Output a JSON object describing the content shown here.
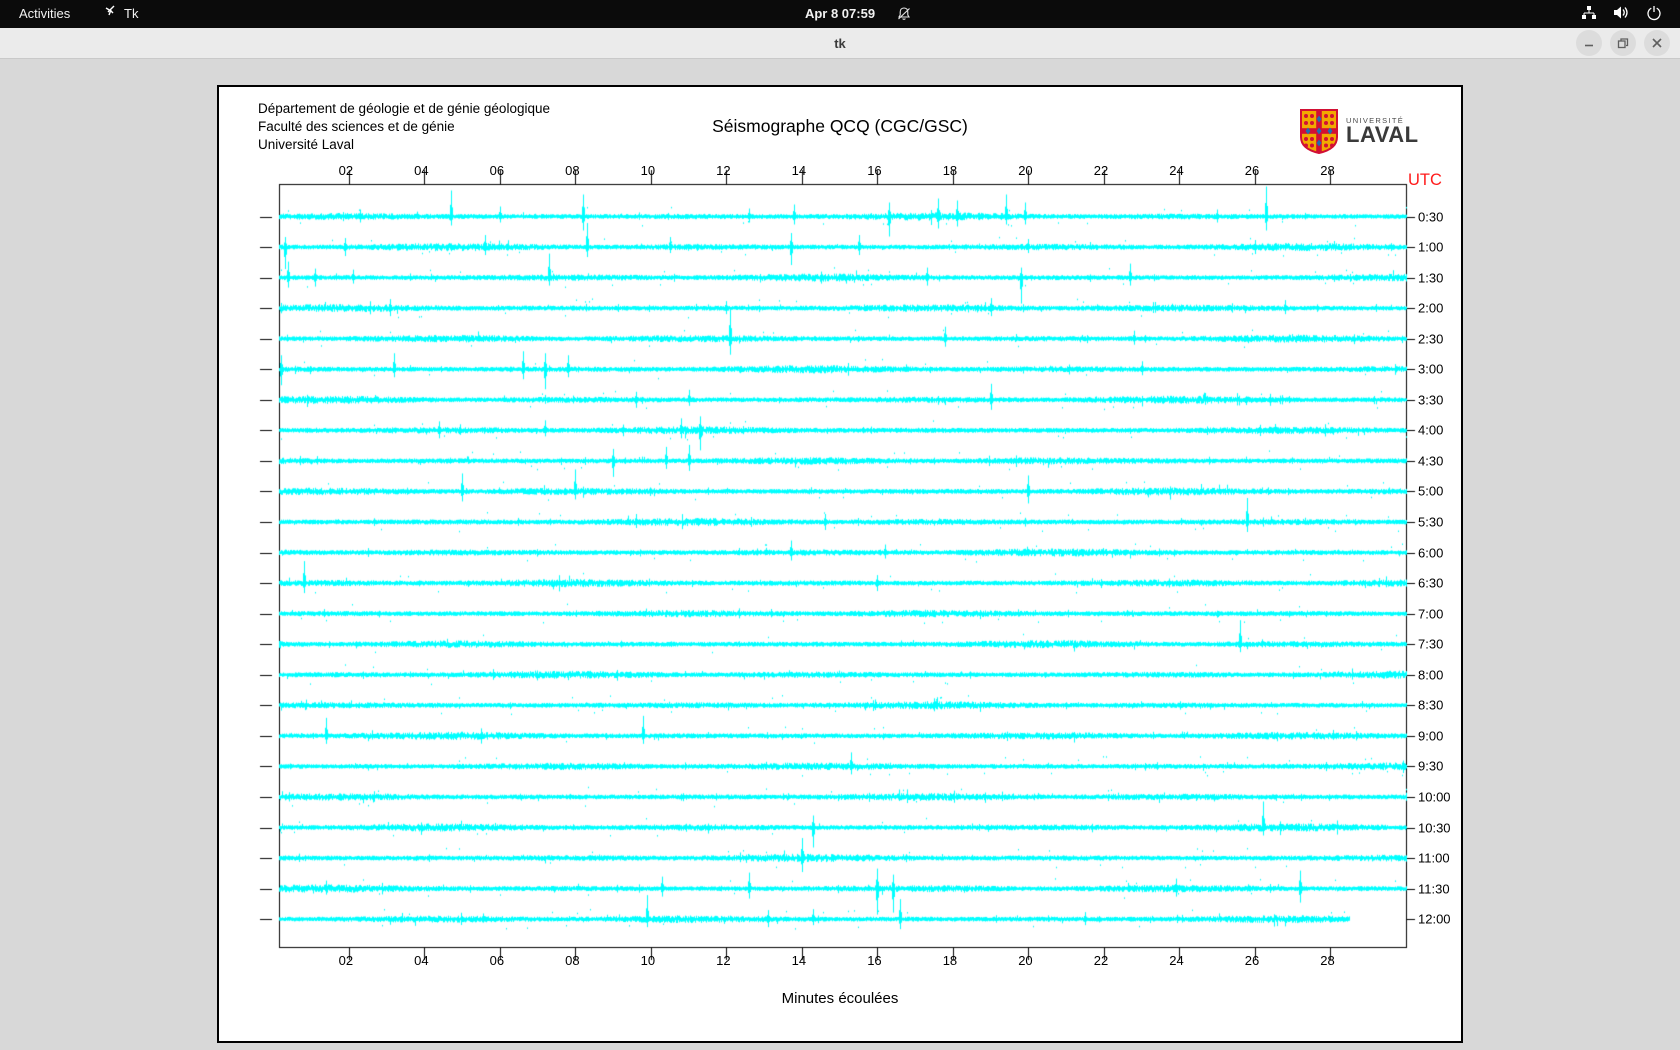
{
  "topbar": {
    "activities": "Activities",
    "app_name": "Tk",
    "clock": "Apr 8 07:59"
  },
  "window": {
    "title": "tk"
  },
  "header": {
    "line1": "Département de géologie et de génie géologique",
    "line2": "Faculté des sciences et de génie",
    "line3": "Université Laval"
  },
  "logo": {
    "small": "UNIVERSITÉ",
    "large": "LAVAL"
  },
  "chart_data": {
    "type": "line",
    "title": "Séismographe QCQ (CGC/GSC)",
    "xlabel": "Minutes écoulées",
    "ylabel": "UTC",
    "xlim": [
      0.15,
      30
    ],
    "x_ticks": [
      "02",
      "04",
      "06",
      "08",
      "10",
      "12",
      "14",
      "16",
      "18",
      "20",
      "22",
      "24",
      "26",
      "28"
    ],
    "x_tick_minutes": [
      2,
      4,
      6,
      8,
      10,
      12,
      14,
      16,
      18,
      20,
      22,
      24,
      26,
      28
    ],
    "trace_color": "#00ffff",
    "axis_color": "#000000",
    "utc_color": "#ff1a1a",
    "noise_seed": 1337,
    "noise_base_amp": 2.4,
    "rows": [
      {
        "label": "0:30",
        "end_minute": 30,
        "spikes": [
          [
            2.3,
            7,
            6
          ],
          [
            4.7,
            26,
            9
          ],
          [
            6.0,
            10,
            6
          ],
          [
            8.2,
            22,
            14
          ],
          [
            12.6,
            8,
            6
          ],
          [
            13.8,
            12,
            8
          ],
          [
            16.3,
            14,
            20
          ],
          [
            17.6,
            18,
            12
          ],
          [
            18.1,
            16,
            10
          ],
          [
            19.4,
            22,
            8
          ],
          [
            19.9,
            14,
            8
          ],
          [
            25.0,
            7,
            6
          ],
          [
            26.3,
            30,
            14
          ]
        ]
      },
      {
        "label": "1:00",
        "end_minute": 30,
        "spikes": [
          [
            0.3,
            10,
            22
          ],
          [
            1.9,
            9,
            9
          ],
          [
            5.6,
            12,
            8
          ],
          [
            8.3,
            24,
            10
          ],
          [
            10.5,
            10,
            6
          ],
          [
            13.7,
            14,
            18
          ],
          [
            15.5,
            12,
            8
          ],
          [
            20.0,
            8,
            6
          ],
          [
            26.0,
            7,
            7
          ]
        ]
      },
      {
        "label": "1:30",
        "end_minute": 30,
        "spikes": [
          [
            0.4,
            16,
            10
          ],
          [
            1.1,
            9,
            9
          ],
          [
            2.1,
            8,
            6
          ],
          [
            7.3,
            24,
            8
          ],
          [
            14.5,
            6,
            6
          ],
          [
            17.3,
            10,
            8
          ],
          [
            19.8,
            10,
            26
          ],
          [
            22.7,
            14,
            8
          ]
        ]
      },
      {
        "label": "2:00",
        "end_minute": 30,
        "spikes": [
          [
            3.1,
            9,
            8
          ],
          [
            12.0,
            7,
            6
          ],
          [
            19.0,
            10,
            8
          ],
          [
            26.8,
            8,
            6
          ]
        ]
      },
      {
        "label": "2:30",
        "end_minute": 30,
        "spikes": [
          [
            12.1,
            30,
            16
          ],
          [
            17.8,
            12,
            8
          ],
          [
            22.8,
            8,
            6
          ]
        ]
      },
      {
        "label": "3:00",
        "end_minute": 30,
        "spikes": [
          [
            0.2,
            14,
            16
          ],
          [
            3.2,
            16,
            8
          ],
          [
            6.6,
            18,
            10
          ],
          [
            7.2,
            16,
            20
          ],
          [
            7.8,
            14,
            8
          ],
          [
            23.0,
            8,
            6
          ]
        ]
      },
      {
        "label": "3:30",
        "end_minute": 30,
        "spikes": [
          [
            9.6,
            8,
            8
          ],
          [
            11.0,
            10,
            6
          ],
          [
            19.0,
            16,
            10
          ],
          [
            26.4,
            6,
            6
          ]
        ]
      },
      {
        "label": "4:00",
        "end_minute": 30,
        "spikes": [
          [
            4.4,
            9,
            8
          ],
          [
            7.2,
            10,
            6
          ],
          [
            10.8,
            12,
            8
          ],
          [
            11.3,
            14,
            20
          ]
        ]
      },
      {
        "label": "4:30",
        "end_minute": 30,
        "spikes": [
          [
            9.0,
            12,
            16
          ],
          [
            10.4,
            14,
            8
          ],
          [
            11.0,
            16,
            10
          ]
        ]
      },
      {
        "label": "5:00",
        "end_minute": 30,
        "spikes": [
          [
            5.0,
            18,
            10
          ],
          [
            8.0,
            22,
            8
          ],
          [
            20.0,
            16,
            12
          ]
        ]
      },
      {
        "label": "5:30",
        "end_minute": 30,
        "spikes": [
          [
            9.6,
            8,
            6
          ],
          [
            14.6,
            8,
            8
          ],
          [
            25.8,
            24,
            10
          ]
        ]
      },
      {
        "label": "6:00",
        "end_minute": 30,
        "spikes": [
          [
            13.7,
            12,
            8
          ],
          [
            16.2,
            8,
            6
          ]
        ]
      },
      {
        "label": "6:30",
        "end_minute": 30,
        "spikes": [
          [
            0.8,
            22,
            10
          ],
          [
            16.0,
            8,
            8
          ]
        ]
      },
      {
        "label": "7:00",
        "end_minute": 30,
        "spikes": []
      },
      {
        "label": "7:30",
        "end_minute": 30,
        "spikes": [
          [
            25.6,
            24,
            8
          ]
        ]
      },
      {
        "label": "8:00",
        "end_minute": 30,
        "spikes": []
      },
      {
        "label": "8:30",
        "end_minute": 30,
        "spikes": [
          [
            17.5,
            7,
            6
          ]
        ]
      },
      {
        "label": "9:00",
        "end_minute": 30,
        "spikes": [
          [
            1.4,
            18,
            8
          ],
          [
            9.8,
            20,
            8
          ]
        ]
      },
      {
        "label": "9:30",
        "end_minute": 30,
        "spikes": [
          [
            15.3,
            14,
            8
          ]
        ]
      },
      {
        "label": "10:00",
        "end_minute": 30,
        "spikes": []
      },
      {
        "label": "10:30",
        "end_minute": 30,
        "spikes": [
          [
            14.3,
            12,
            20
          ],
          [
            26.2,
            26,
            8
          ]
        ]
      },
      {
        "label": "11:00",
        "end_minute": 30,
        "spikes": [
          [
            14.0,
            20,
            14
          ]
        ]
      },
      {
        "label": "11:30",
        "end_minute": 30,
        "spikes": [
          [
            1.4,
            8,
            6
          ],
          [
            10.3,
            12,
            8
          ],
          [
            12.6,
            16,
            10
          ],
          [
            16.0,
            20,
            26
          ],
          [
            16.4,
            14,
            24
          ],
          [
            23.9,
            10,
            8
          ],
          [
            27.2,
            18,
            14
          ]
        ]
      },
      {
        "label": "12:00",
        "end_minute": 28.5,
        "spikes": [
          [
            9.9,
            24,
            8
          ],
          [
            13.1,
            9,
            8
          ],
          [
            14.3,
            10,
            6
          ],
          [
            16.6,
            20,
            10
          ],
          [
            21.5,
            7,
            6
          ]
        ]
      }
    ]
  }
}
